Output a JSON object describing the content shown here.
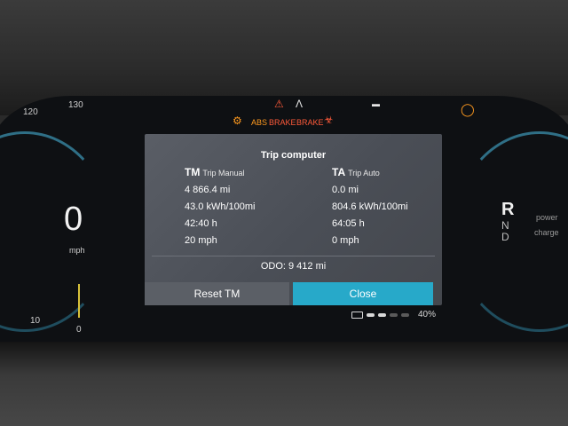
{
  "cluster": {
    "speed_ticks": [
      "120",
      "130",
      "10",
      "0"
    ],
    "speed_value": "0",
    "speed_unit": "mph",
    "gears": [
      "R",
      "N",
      "D"
    ],
    "power_label": "power",
    "charge_label": "charge",
    "warnings": {
      "abs_label": "ABS",
      "brake_label_1": "BRAKE",
      "brake_label_2": "BRAKE"
    },
    "battery_percent": "40%",
    "battery_level": 0.4
  },
  "trip_computer": {
    "title": "Trip computer",
    "manual": {
      "code": "TM",
      "name": "Trip Manual",
      "distance": "4 866.4 mi",
      "energy": "43.0 kWh/100mi",
      "time": "42:40 h",
      "avg_speed": "20 mph"
    },
    "auto": {
      "code": "TA",
      "name": "Trip Auto",
      "distance": "0.0 mi",
      "energy": "804.6 kWh/100mi",
      "time": "64:05 h",
      "avg_speed": "0 mph"
    },
    "odo": "ODO:  9 412 mi",
    "reset_label": "Reset TM",
    "close_label": "Close"
  },
  "colors": {
    "close_button": "#27a9c9",
    "popup_bg": "#4e525a",
    "warning_amber": "#ff9a1f",
    "warning_red": "#ff5a3a"
  }
}
